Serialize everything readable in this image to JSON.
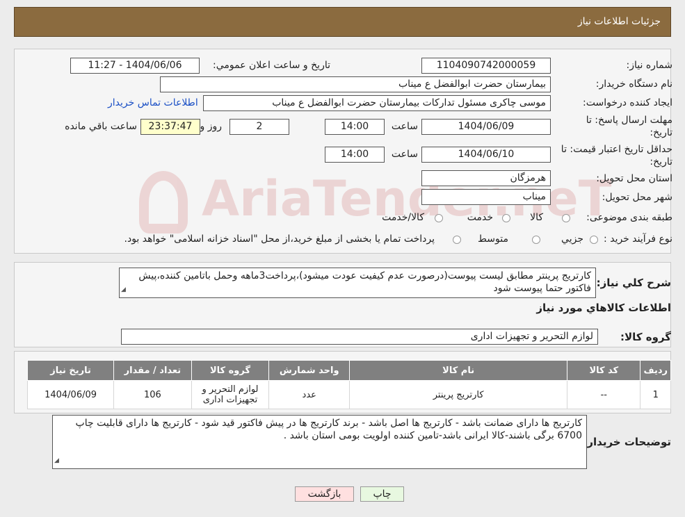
{
  "header": {
    "title": "جزئیات اطلاعات نیاز"
  },
  "form": {
    "need_number_label": "شماره نیاز:",
    "need_number": "1104090742000059",
    "announce_label": "تاریخ و ساعت اعلان عمومي:",
    "announce_value": "1404/06/06 - 11:27",
    "buyer_label": "نام دستگاه خريدار:",
    "buyer_value": "بیمارستان حضرت ابوالفضل ع  میناب",
    "creator_label": "ايجاد کننده درخواست:",
    "creator_value": "موسی چاکری مسئول تدارکات بیمارستان حضرت ابوالفضل ع  میناب",
    "contact_link": "اطلاعات تماس خريدار",
    "deadline_label_1": "مهلت ارسال پاسخ: تا",
    "deadline_label_2": "تاریخ:",
    "deadline_date": "1404/06/09",
    "time_label": "ساعت",
    "deadline_time": "14:00",
    "days_value": "2",
    "days_label": "روز و",
    "remaining_time": "23:37:47",
    "remaining_label": "ساعت باقي مانده",
    "validity_label_1": "حداقل تاريخ اعتبار قيمت: تا",
    "validity_label_2": "تاريخ:",
    "validity_date": "1404/06/10",
    "validity_time": "14:00",
    "province_label": "استان محل تحويل:",
    "province_value": "هرمزگان",
    "city_label": "شهر محل تحويل:",
    "city_value": "میناب",
    "category_label": "طبقه بندی موضوعی:",
    "category_options": [
      "کالا",
      "خدمت",
      "کالا/خدمت"
    ],
    "process_label": "نوع فرآيند خريد :",
    "process_options": [
      "جزيي",
      "متوسط"
    ],
    "process_note": "پرداخت تمام یا بخشی از مبلغ خرید،از محل \"اسناد خزانه اسلامی\" خواهد بود."
  },
  "summary": {
    "label": "شرح کلي نياز:",
    "text": "کارتریج پرینتر مطابق لیست پیوست(درصورت عدم کیفیت عودت میشود)،پرداخت3ماهه وحمل باتامین کننده،پیش فاکتور حتما پیوست شود",
    "items_heading": "اطلاعات کالاهاي مورد نياز",
    "group_label": "گروه کالا:",
    "group_value": "لوازم التحریر و تجهیزات اداری"
  },
  "table": {
    "headers": [
      "رديف",
      "کد کالا",
      "نام کالا",
      "واحد شمارش",
      "گروه کالا",
      "تعداد / مقدار",
      "تاريخ نياز"
    ],
    "rows": [
      [
        "1",
        "--",
        "کارتریج پرینتر",
        "عدد",
        "لوازم التحریر و تجهیزات اداری",
        "106",
        "1404/06/09"
      ]
    ]
  },
  "buyer_notes": {
    "label": "توضيحات خريدار:",
    "text": "کارتریج ها دارای ضمانت باشد - کارتریج ها اصل باشد - برند کارتریج ها در پیش فاکتور قید شود - کارتریج ها دارای قابلیت چاپ 6700 برگی باشند-کالا ایرانی باشد-تامین کننده اولویت بومی استان باشد ."
  },
  "buttons": {
    "print": "چاپ",
    "back": "بازگشت"
  },
  "watermark": {
    "text": "AriaTender.neT"
  },
  "colors": {
    "header": "#8b6b3f",
    "table_header": "#808080",
    "back_button": "#ffe0e0",
    "print_button": "#e8f8e0"
  }
}
